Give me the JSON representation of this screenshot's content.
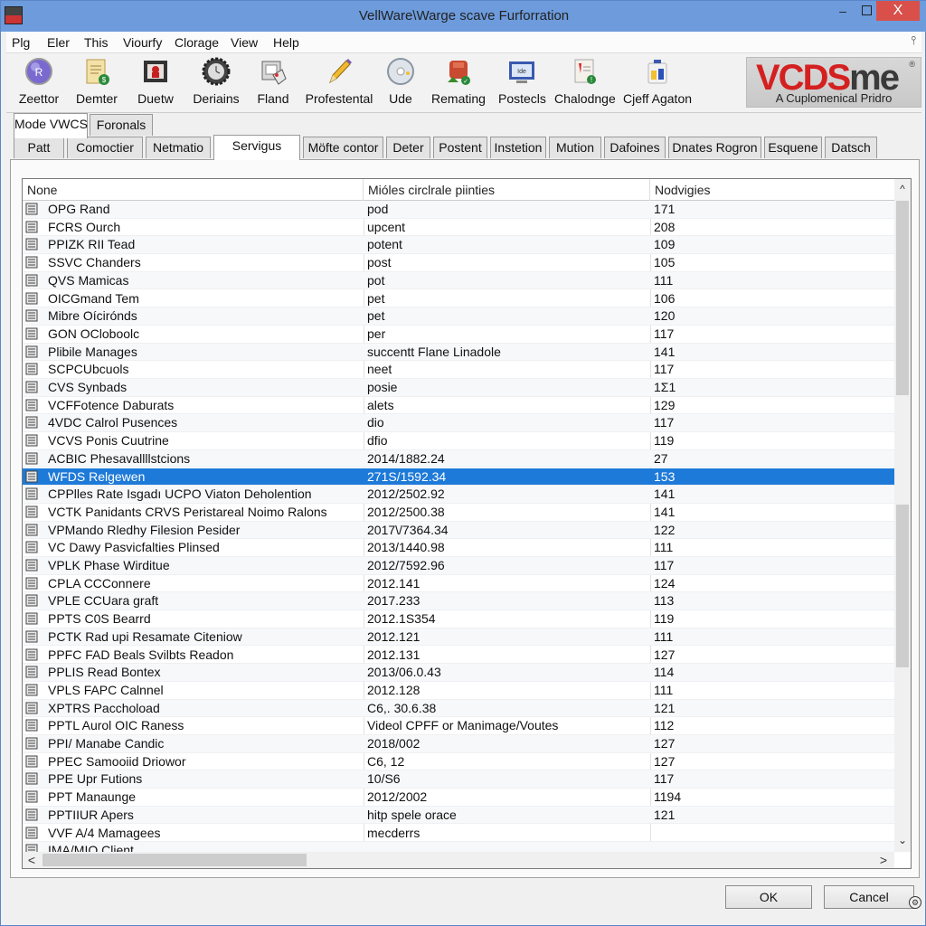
{
  "window": {
    "title": "VellWare\\Warge scave Furforration",
    "minimize_label": "–",
    "close_label": "X"
  },
  "menu": {
    "items": [
      "Plg",
      "Eler",
      "This",
      "Viourfy",
      "Clorage",
      "View",
      "Help"
    ],
    "pin_icon": "pin-icon"
  },
  "toolbar": {
    "items": [
      {
        "label": "Zeettor",
        "icon": "globe-icon"
      },
      {
        "label": "Demter",
        "icon": "document-icon"
      },
      {
        "label": "Duetw",
        "icon": "film-icon"
      },
      {
        "label": "Deriains",
        "icon": "gear-icon"
      },
      {
        "label": "Fland",
        "icon": "folder-tag-icon"
      },
      {
        "label": "Profestental",
        "icon": "pencil-icon"
      },
      {
        "label": "Ude",
        "icon": "disc-icon"
      },
      {
        "label": "Remating",
        "icon": "engine-icon"
      },
      {
        "label": "Postecls",
        "icon": "monitor-icon"
      },
      {
        "label": "Chalodnge",
        "icon": "clipboard-alert-icon"
      },
      {
        "label": "Cjeff Agaton",
        "icon": "jar-icon"
      }
    ]
  },
  "logo": {
    "part1": "VCDS",
    "part2": "me",
    "registered": "®",
    "subtitle": "A Cuplomenical Pridro",
    "colors": {
      "red": "#d42020",
      "dark": "#3a3a3a"
    }
  },
  "tabs_row1": [
    {
      "label": "Mode VWCS",
      "active": true
    },
    {
      "label": "Foronals",
      "active": false
    }
  ],
  "tabs_row2": [
    {
      "label": "Patt",
      "active": false
    },
    {
      "label": "Comoctier",
      "active": false
    },
    {
      "label": "Netmatio",
      "active": false
    },
    {
      "label": "Servigus",
      "active": true
    },
    {
      "label": "Möfte contor",
      "active": false
    },
    {
      "label": "Deter",
      "active": false
    },
    {
      "label": "Postent",
      "active": false
    },
    {
      "label": "Instetion",
      "active": false
    },
    {
      "label": "Mution",
      "active": false
    },
    {
      "label": "Dafoines",
      "active": false
    },
    {
      "label": "Dnates Rogron",
      "active": false
    },
    {
      "label": "Esquene",
      "active": false
    },
    {
      "label": "Datsch",
      "active": false
    }
  ],
  "list": {
    "columns": [
      "None",
      "Mióles circlrale piinties",
      "Nodvigies"
    ],
    "selected_index": 15,
    "selection_color": "#1e7ad8",
    "rows": [
      {
        "name": "OPG Rand",
        "value": "pod",
        "count": "171"
      },
      {
        "name": "FCRS Ourch",
        "value": "upcent",
        "count": "208"
      },
      {
        "name": "PPIZK RII Tead",
        "value": "potent",
        "count": "109"
      },
      {
        "name": "SSVC Chanders",
        "value": "post",
        "count": "105"
      },
      {
        "name": " QVS Mamicas",
        "value": "pot",
        "count": "111"
      },
      {
        "name": " OICGmand Tem",
        "value": "pet",
        "count": "106"
      },
      {
        "name": "Mibre Oícirónds",
        "value": "pet",
        "count": "120"
      },
      {
        "name": "GON OCloboolc",
        "value": "per",
        "count": "117"
      },
      {
        "name": "Plibile Manages",
        "value": "succentt Flane Linadole",
        "count": "141"
      },
      {
        "name": "SCPCUbcuols",
        "value": "neet",
        "count": "117"
      },
      {
        "name": "CVS Synbads",
        "value": "posie",
        "count": "1Σ1"
      },
      {
        "name": "VCFFotence Daburats",
        "value": "alets",
        "count": "129"
      },
      {
        "name": " 4VDC Calrol Pusences",
        "value": "dio",
        "count": "117"
      },
      {
        "name": "VCVS Ponis Cuutrine",
        "value": "dfio",
        "count": "119"
      },
      {
        "name": "  ACBIC Phesavallllstcions",
        "value": "2014/1882.24",
        "count": " 27"
      },
      {
        "name": "WFDS Relgewen",
        "value": "271S/1592.34",
        "count": "153"
      },
      {
        "name": "CPPlles Rate Isgadı UCPO Viaton Deholention",
        "value": "2012/2502.92",
        "count": "141"
      },
      {
        "name": "VCTK Panidants CRVS Peristareal Noimo Ralons",
        "value": "2012/2500.38",
        "count": "141"
      },
      {
        "name": "VPMando Rledhy Filesion Pesider",
        "value": "2017\\/7364.34",
        "count": "122"
      },
      {
        "name": "VC Dawy Pasvicfalties Plinsed",
        "value": "2013/1440.98",
        "count": "111"
      },
      {
        "name": "VPLK Phase Wirditue",
        "value": "2012/7592.96",
        "count": "117"
      },
      {
        "name": "CPLA CCConnere",
        "value": "2012.141",
        "count": "124"
      },
      {
        "name": "VPLE CCUara graft",
        "value": "2017.233",
        "count": "113"
      },
      {
        "name": "PPTS C0S Bearrd",
        "value": "2012.1S354",
        "count": "119"
      },
      {
        "name": "PCTK Rad upi Resamate Citeniow",
        "value": "2012.121",
        "count": "111"
      },
      {
        "name": "PPFC FAD Beals Svilbts Readon",
        "value": "2012.131",
        "count": "127"
      },
      {
        "name": "PPLIS Read Bontex",
        "value": "2013/06.0.43",
        "count": "114"
      },
      {
        "name": "VPLS FAPC Calnnel",
        "value": "2012.128",
        "count": "111"
      },
      {
        "name": "XPTRS Pacchoload",
        "value": "C6,. 30.6.38",
        "count": "121"
      },
      {
        "name": "PPTL Aurol OIC Raness",
        "value": "Videol CPFF or Manimage/Voutes",
        "count": "112"
      },
      {
        "name": "PPI/ Manabe Candic",
        "value": "2018/002",
        "count": "127"
      },
      {
        "name": "PPEC Samooiid Driowor",
        "value": "C6, 12",
        "count": "127"
      },
      {
        "name": "PPE Upr Futions",
        "value": "10/S6",
        "count": "117"
      },
      {
        "name": "PPT Manaunge",
        "value": "2012/2002",
        "count": "1194"
      },
      {
        "name": "PPTIIUR Apers",
        "value": "hitp spele orace",
        "count": "121"
      },
      {
        "name": "VVF A/4 Mamagees",
        "value": "mecderrs",
        "count": ""
      },
      {
        "name": "IMA/MIO Client",
        "value": "",
        "count": ""
      }
    ]
  },
  "buttons": {
    "ok": "OK",
    "cancel": "Cancel"
  },
  "scroll": {
    "up": "^",
    "down": "⌄",
    "left": "<",
    "right": ">"
  }
}
